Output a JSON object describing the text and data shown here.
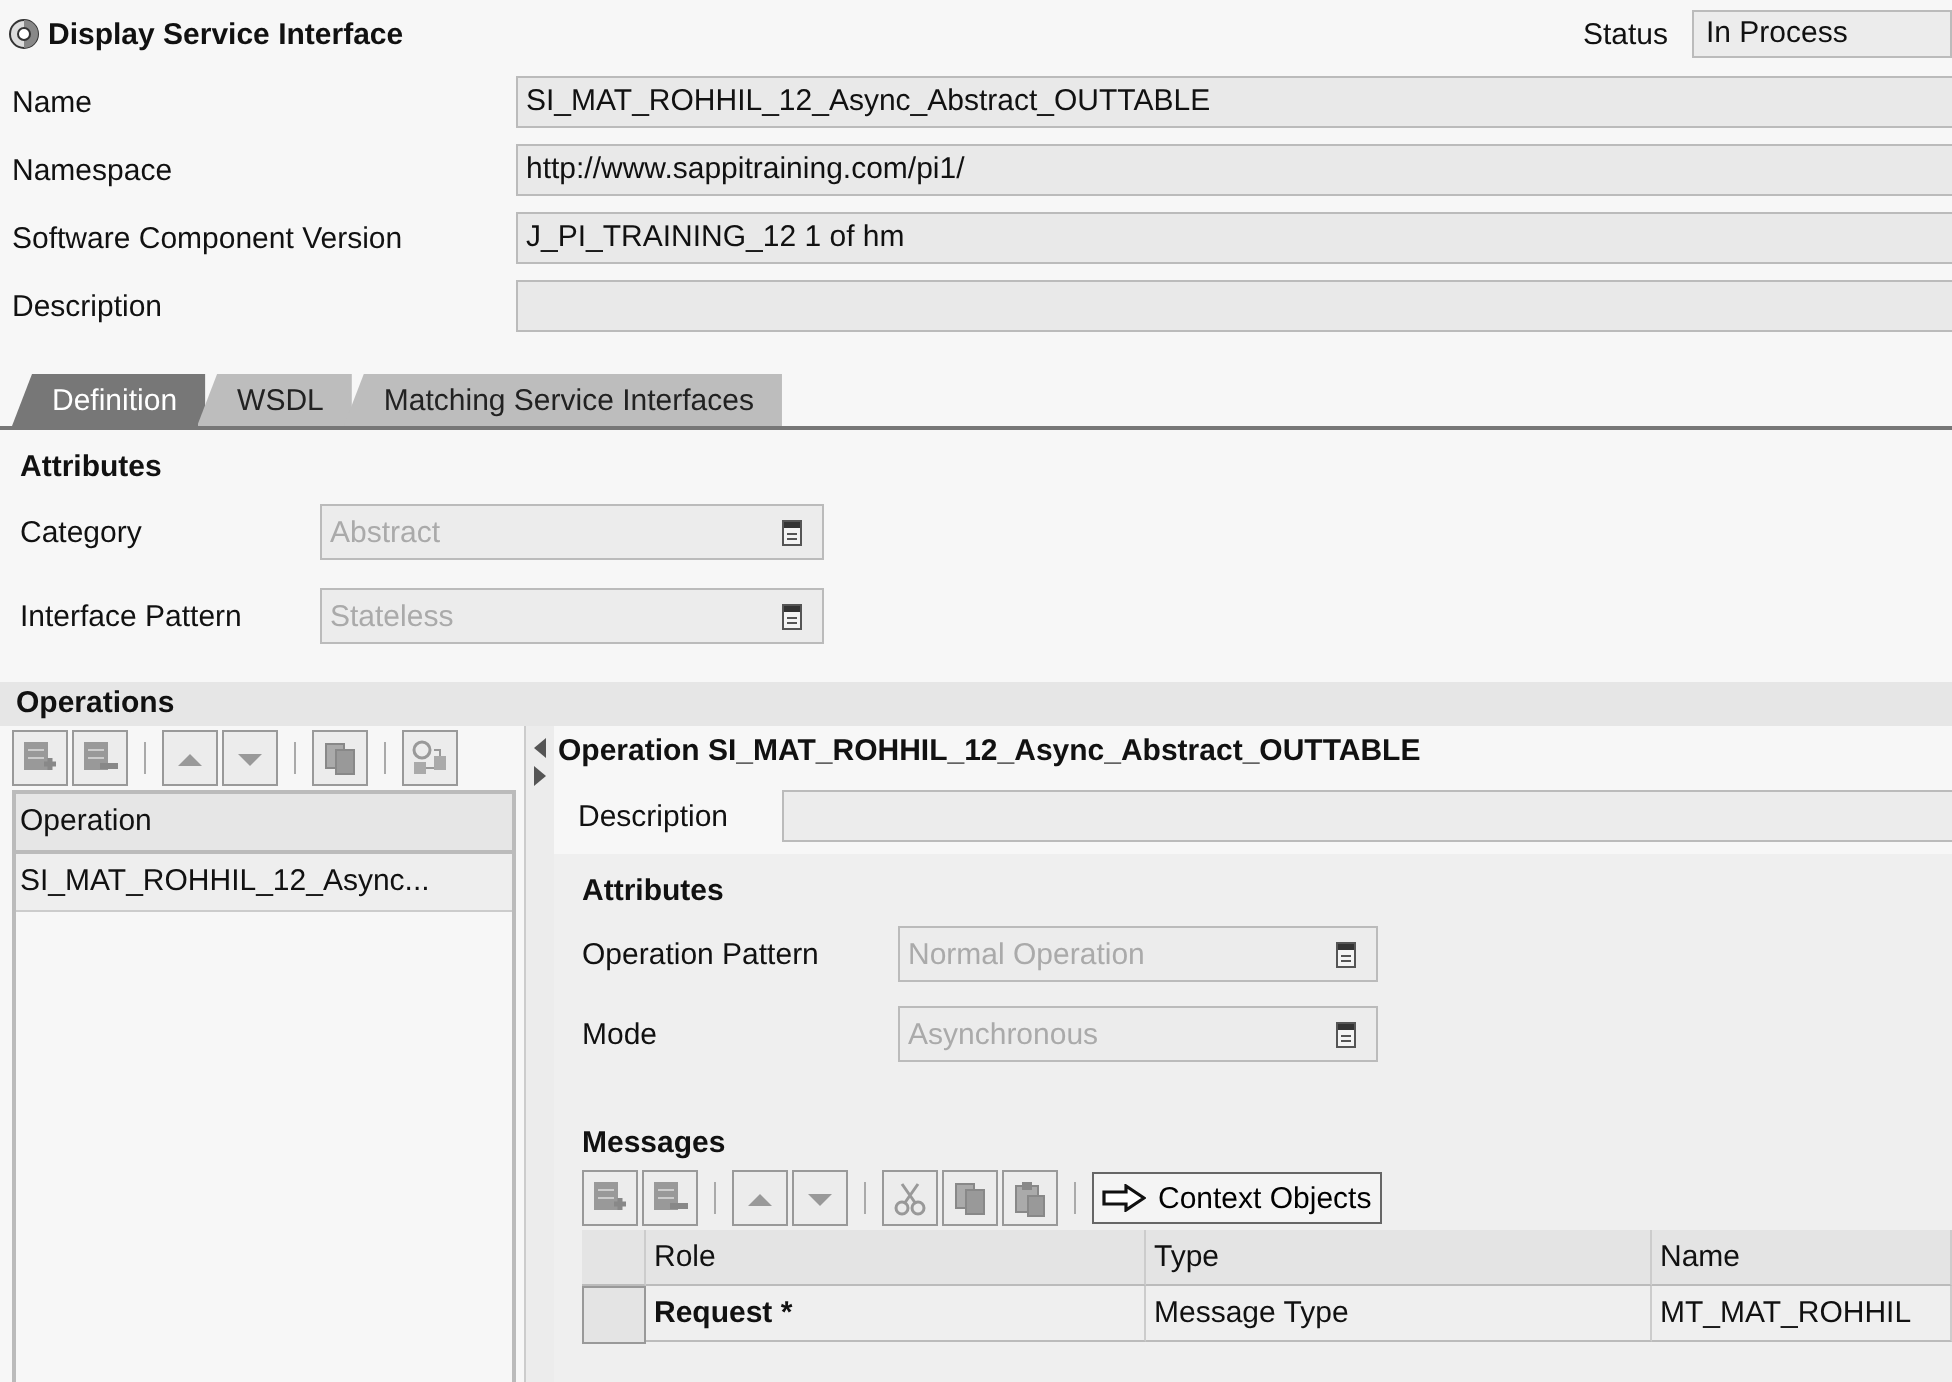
{
  "header": {
    "title": "Display Service Interface",
    "status_label": "Status",
    "status_value": "In Process"
  },
  "fields": [
    {
      "label": "Name",
      "value": "SI_MAT_ROHHIL_12_Async_Abstract_OUTTABLE"
    },
    {
      "label": "Namespace",
      "value": "http://www.sappitraining.com/pi1/"
    },
    {
      "label": "Software Component Version",
      "value": "J_PI_TRAINING_12 1 of hm"
    },
    {
      "label": "Description"
    }
  ],
  "tabs": [
    {
      "label": "Definition",
      "selected": true
    },
    {
      "label": "WSDL",
      "selected": false
    },
    {
      "label": "Matching Service Interfaces",
      "selected": false
    }
  ],
  "attributes": {
    "heading": "Attributes",
    "fields": [
      {
        "label": "Category",
        "value": "Abstract",
        "disabled": true
      },
      {
        "label": "Interface Pattern",
        "value": "Stateless",
        "disabled": true
      }
    ]
  },
  "operations": {
    "heading": "Operations",
    "column": "Operation",
    "rows": [
      {
        "name": "SI_MAT_ROHHIL_12_Async...",
        "selected": false
      }
    ],
    "detail": {
      "title": "Operation SI_MAT_ROHHIL_12_Async_Abstract_OUTTABLE",
      "description_label": "Description",
      "attributes_heading": "Attributes",
      "fields": [
        {
          "label": "Operation Pattern",
          "value": "Normal Operation",
          "disabled": true
        },
        {
          "label": "Mode",
          "value": "Asynchronous",
          "disabled": true
        }
      ],
      "messages": {
        "heading": "Messages",
        "context_button": "Context Objects",
        "columns": [
          "Role",
          "Type",
          "Name"
        ],
        "rows": [
          {
            "role": "Request *",
            "type": "Message Type",
            "name": "MT_MAT_ROHHIL"
          }
        ]
      }
    }
  }
}
